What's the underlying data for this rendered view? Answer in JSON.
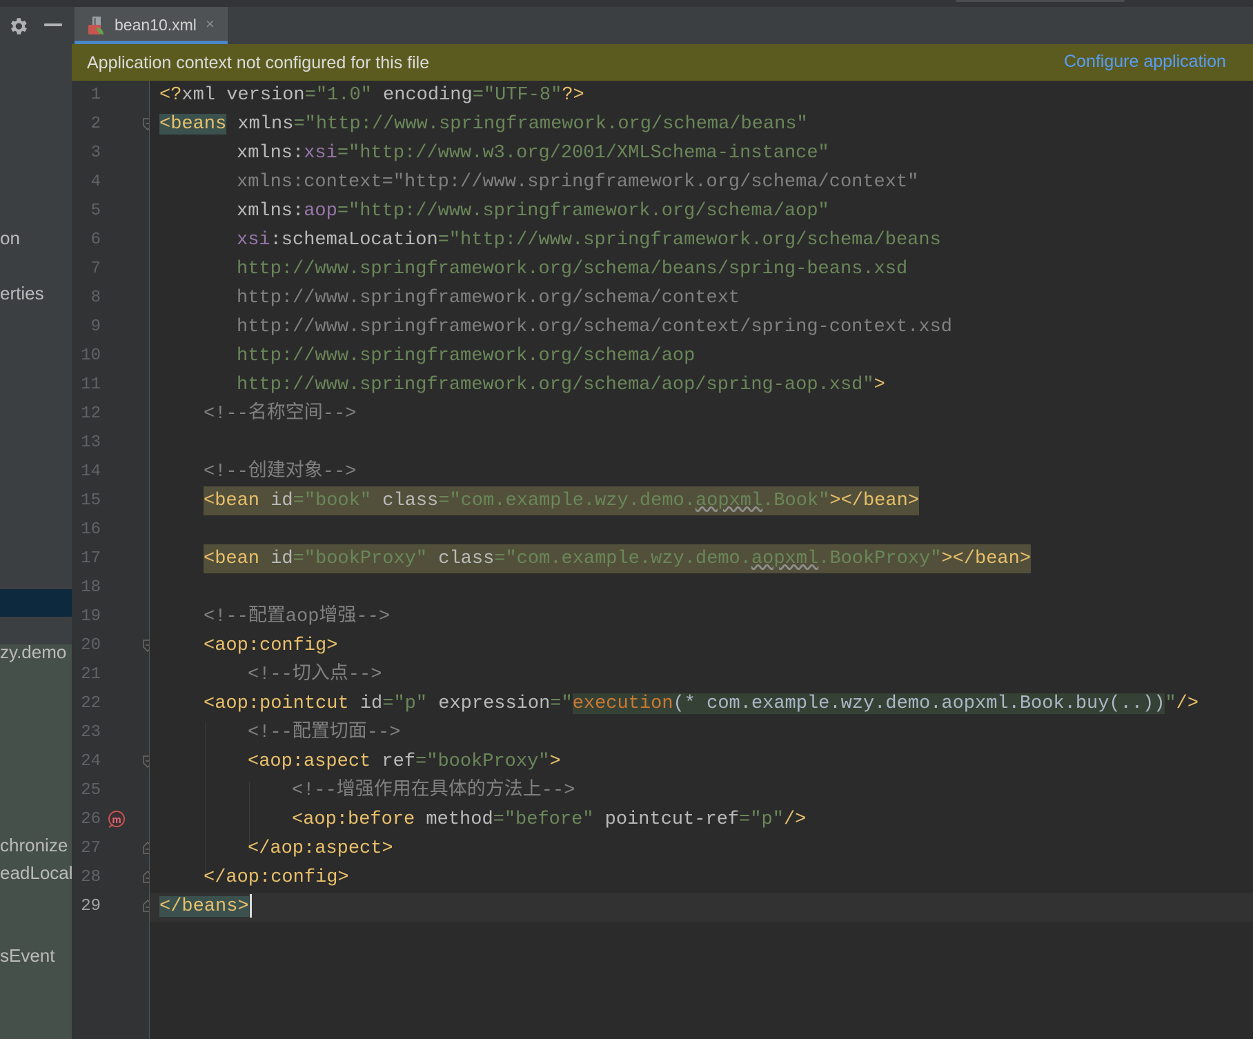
{
  "sidebar": {
    "fragments": [
      "on",
      "erties",
      "zy.demo",
      "chronize",
      "eadLocal",
      "sEvent"
    ]
  },
  "tabs": [
    {
      "label": "bean10.xml",
      "close": "×",
      "icon": "spring-xml-file-icon",
      "active": true
    }
  ],
  "notification": {
    "message": "Application context not configured for this file",
    "action": "Configure application"
  },
  "editor": {
    "current_line": 29,
    "line_numbers": [
      "1",
      "2",
      "3",
      "4",
      "5",
      "6",
      "7",
      "8",
      "9",
      "10",
      "11",
      "12",
      "13",
      "14",
      "15",
      "16",
      "17",
      "18",
      "19",
      "20",
      "21",
      "22",
      "23",
      "24",
      "25",
      "26",
      "27",
      "28",
      "29"
    ],
    "lines": {
      "l1": {
        "a": "<?",
        "b": "xml ",
        "c": "version",
        "d": "=\"1.0\"",
        "e": " encoding",
        "f": "=\"UTF-8\"",
        "g": "?>"
      },
      "l2": {
        "a": "<beans",
        "b": " xmlns",
        "c": "=\"http://www.springframework.org/schema/beans\""
      },
      "l3": {
        "a": "xmlns:",
        "b": "xsi",
        "c": "=\"http://www.w3.org/2001/XMLSchema-instance\""
      },
      "l4": {
        "a": "xmlns:context=\"http://www.springframework.org/schema/context\""
      },
      "l5": {
        "a": "xmlns:",
        "b": "aop",
        "c": "=\"http://www.springframework.org/schema/aop\""
      },
      "l6": {
        "a": "xsi",
        "b": ":schemaLocation",
        "c": "=\"http://www.springframework.org/schema/beans"
      },
      "l7": {
        "a": "http://www.springframework.org/schema/beans/spring-beans.xsd"
      },
      "l8": {
        "a": "http://www.springframework.org/schema/context"
      },
      "l9": {
        "a": "http://www.springframework.org/schema/context/spring-context.xsd"
      },
      "l10": {
        "a": "http://www.springframework.org/schema/aop"
      },
      "l11": {
        "a": "http://www.springframework.org/schema/aop/spring-aop.xsd\"",
        "b": ">"
      },
      "l12": {
        "a": "<!--名称空间-->"
      },
      "l14": {
        "a": "<!--创建对象-->"
      },
      "l15": {
        "a": "<bean",
        "b": " id",
        "c": "=\"book\"",
        "d": " class",
        "e": "=\"com.example.wzy.demo.",
        "f": "aopxml",
        "g": ".Book\"",
        "h": "></bean>"
      },
      "l17": {
        "a": "<bean",
        "b": " id",
        "c": "=\"bookProxy\"",
        "d": " class",
        "e": "=\"com.example.wzy.demo.",
        "f": "aopxml",
        "g": ".BookProxy\"",
        "h": "></bean>"
      },
      "l19": {
        "a": "<!--配置aop增强-->"
      },
      "l20": {
        "a": "<aop:config>"
      },
      "l21": {
        "a": "<!--切入点-->"
      },
      "l22": {
        "a": "<aop:pointcut",
        "b": " id",
        "c": "=\"p\"",
        "d": " expression",
        "e": "=\"",
        "f": "execution",
        "g": "(* com.example.wzy.demo.aopxml.Book.buy(..))",
        "h": "\"",
        "i": "/>"
      },
      "l23": {
        "a": "<!--配置切面-->"
      },
      "l24": {
        "a": "<aop:aspect",
        "b": " ref",
        "c": "=\"bookProxy\"",
        "d": ">"
      },
      "l25": {
        "a": "<!--增强作用在具体的方法上-->"
      },
      "l26": {
        "a": "<aop:before",
        "b": " method",
        "c": "=\"before\"",
        "d": " pointcut-ref",
        "e": "=\"p\"",
        "f": "/>"
      },
      "l27": {
        "a": "</aop:aspect>"
      },
      "l28": {
        "a": "</aop:config>"
      },
      "l29": {
        "a": "</beans>"
      }
    }
  },
  "colors": {
    "tag": "#e8bf6a",
    "attr": "#bababa",
    "value": "#6a8759",
    "namespace": "#9876aa",
    "comment": "#808080",
    "link": "#589df6",
    "notification_bg": "#5b5b1f"
  }
}
